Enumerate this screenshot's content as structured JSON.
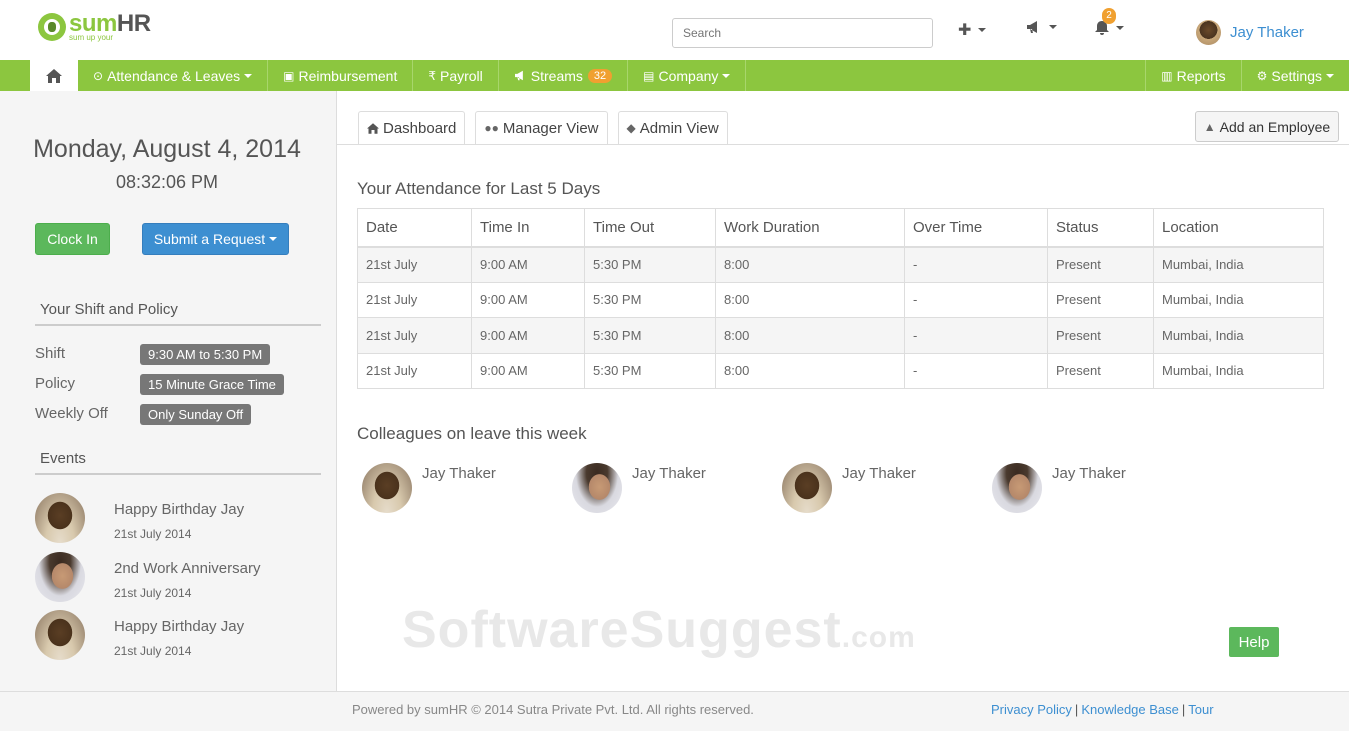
{
  "brand": {
    "logo_sum": "sum",
    "logo_hr": "HR",
    "tagline": "sum up your"
  },
  "header": {
    "search_placeholder": "Search",
    "add_icon": "plus-icon",
    "announce_icon": "bullhorn-icon",
    "bell_icon": "bell-icon",
    "notification_count": "2",
    "user_name": "Jay Thaker"
  },
  "nav": {
    "home_icon": "home-icon",
    "items": [
      {
        "label": "Attendance & Leaves",
        "icon": "clock-icon"
      },
      {
        "label": "Reimbursement",
        "icon": "money-icon"
      },
      {
        "label": "Payroll",
        "icon": "rupee-icon"
      },
      {
        "label": "Streams",
        "icon": "bullhorn-icon",
        "badge": "32"
      },
      {
        "label": "Company",
        "icon": "building-icon"
      }
    ],
    "right": [
      {
        "label": "Reports",
        "icon": "chart-icon"
      },
      {
        "label": "Settings",
        "icon": "gear-icon"
      }
    ]
  },
  "sidebar": {
    "date": "Monday, August 4, 2014",
    "time": "08:32:06 PM",
    "clock_in": "Clock In",
    "submit_request": "Submit a Request",
    "shift_title": "Your Shift and Policy",
    "shift_label": "Shift",
    "shift_value": "9:30 AM to 5:30 PM",
    "policy_label": "Policy",
    "policy_value": "15 Minute Grace Time",
    "weekly_label": "Weekly Off",
    "weekly_value": "Only Sunday Off",
    "events_title": "Events",
    "events": [
      {
        "title": "Happy Birthday Jay",
        "date": "21st July 2014"
      },
      {
        "title": "2nd Work Anniversary",
        "date": "21st July 2014"
      },
      {
        "title": "Happy Birthday Jay",
        "date": "21st July 2014"
      }
    ]
  },
  "main": {
    "tabs": [
      {
        "label": "Dashboard",
        "icon": "home-icon"
      },
      {
        "label": "Manager View",
        "icon": "users-icon"
      },
      {
        "label": "Admin View",
        "icon": "graduation-cap-icon"
      }
    ],
    "add_employee": "Add an Employee",
    "attendance_title": "Your Attendance for Last 5 Days",
    "columns": [
      "Date",
      "Time In",
      "Time Out",
      "Work Duration",
      "Over Time",
      "Status",
      "Location"
    ],
    "rows": [
      [
        "21st July",
        "9:00 AM",
        "5:30 PM",
        "8:00",
        "-",
        "Present",
        "Mumbai, India"
      ],
      [
        "21st July",
        "9:00 AM",
        "5:30 PM",
        "8:00",
        "-",
        "Present",
        "Mumbai, India"
      ],
      [
        "21st July",
        "9:00 AM",
        "5:30 PM",
        "8:00",
        "-",
        "Present",
        "Mumbai, India"
      ],
      [
        "21st July",
        "9:00 AM",
        "5:30 PM",
        "8:00",
        "-",
        "Present",
        "Mumbai, India"
      ]
    ],
    "colleagues_title": "Colleagues on leave this week",
    "colleagues": [
      {
        "name": "Jay Thaker"
      },
      {
        "name": "Jay Thaker"
      },
      {
        "name": "Jay Thaker"
      },
      {
        "name": "Jay Thaker"
      }
    ],
    "watermark": "SoftwareSuggest",
    "watermark_suffix": ".com",
    "help": "Help"
  },
  "footer": {
    "copyright": "Powered by sumHR © 2014 Sutra Private Pvt. Ltd. All rights reserved.",
    "privacy": "Privacy Policy",
    "sep": "|",
    "knowledge": "Knowledge Base",
    "tour": "Tour"
  },
  "colors": {
    "accent_green": "#8cc63f",
    "link_blue": "#3d8fd1",
    "badge_orange": "#f0a030",
    "success_green": "#5cb85c"
  }
}
